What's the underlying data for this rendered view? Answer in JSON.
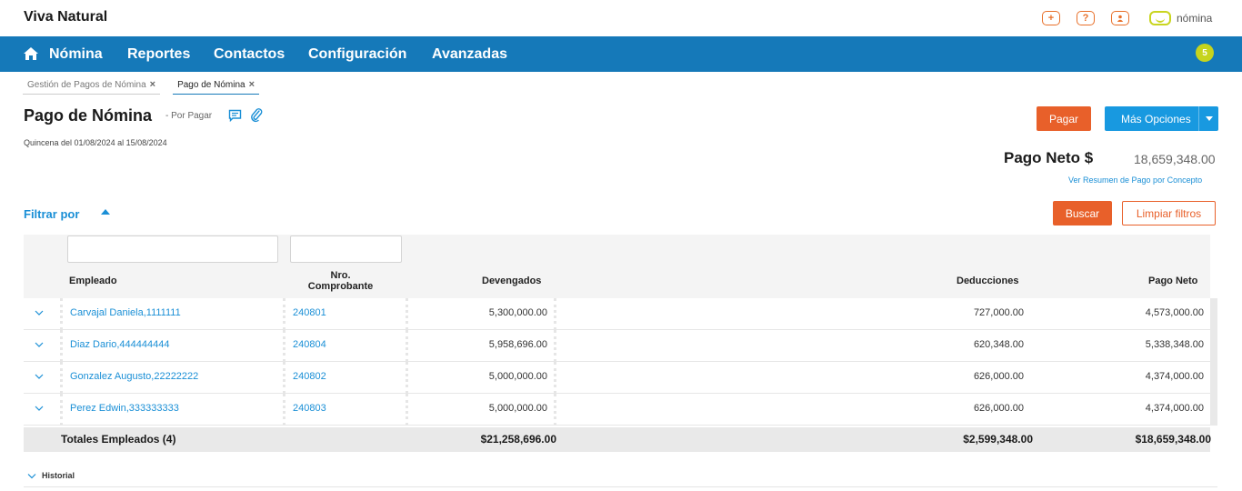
{
  "app": {
    "brand": "Viva Natural",
    "logo_text": "nómina"
  },
  "top_icons": [
    {
      "icon": "plus-icon",
      "glyph": "+"
    },
    {
      "icon": "help-icon",
      "glyph": "?"
    },
    {
      "icon": "user-icon",
      "glyph": "●"
    }
  ],
  "nav": {
    "items": [
      "Nómina",
      "Reportes",
      "Contactos",
      "Configuración",
      "Avanzadas"
    ],
    "badge": "5"
  },
  "tabs": [
    {
      "label": "Gestión de Pagos de Nómina",
      "close": "×"
    },
    {
      "label": "Pago de Nómina",
      "close": "×"
    }
  ],
  "page": {
    "title": "Pago de Nómina",
    "status": "- Por Pagar",
    "period": "Quincena del 01/08/2024 al 15/08/2024",
    "pay_button": "Pagar",
    "more_button": "Más Opciones",
    "net_label": "Pago Neto $",
    "net_value": "18,659,348.00",
    "summary_link": "Ver Resumen de Pago por Concepto",
    "filter_label": "Filtrar por",
    "search_button": "Buscar",
    "clear_button": "Limpiar filtros"
  },
  "table": {
    "headers": {
      "employee": "Empleado",
      "voucher_line1": "Nro.",
      "voucher_line2": "Comprobante",
      "accrued": "Devengados",
      "deductions": "Deducciones",
      "net": "Pago Neto"
    },
    "rows": [
      {
        "employee": "Carvajal Daniela,1111111",
        "voucher": "240801",
        "accrued": "5,300,000.00",
        "deductions": "727,000.00",
        "net": "4,573,000.00"
      },
      {
        "employee": "Diaz Dario,444444444",
        "voucher": "240804",
        "accrued": "5,958,696.00",
        "deductions": "620,348.00",
        "net": "5,338,348.00"
      },
      {
        "employee": "Gonzalez Augusto,22222222",
        "voucher": "240802",
        "accrued": "5,000,000.00",
        "deductions": "626,000.00",
        "net": "4,374,000.00"
      },
      {
        "employee": "Perez Edwin,333333333",
        "voucher": "240803",
        "accrued": "5,000,000.00",
        "deductions": "626,000.00",
        "net": "4,374,000.00"
      }
    ],
    "totals": {
      "label": "Totales Empleados (4)",
      "accrued": "$21,258,696.00",
      "deductions": "$2,599,348.00",
      "net": "$18,659,348.00"
    }
  },
  "history": {
    "label": "Historial"
  },
  "colors": {
    "nav_bg": "#1579b9",
    "accent_orange": "#e8602a",
    "accent_blue": "#1899e0",
    "link_blue": "#1a8fd6",
    "badge_green": "#c6d41d"
  }
}
